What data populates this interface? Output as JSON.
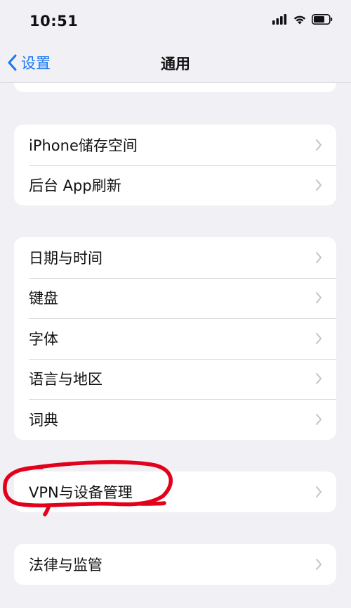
{
  "status_bar": {
    "time": "10:51",
    "icons": [
      "cellular-icon",
      "wifi-icon",
      "battery-icon"
    ]
  },
  "nav": {
    "back_label": "设置",
    "title": "通用",
    "accent_color": "#1877f2"
  },
  "groups": [
    {
      "items": [
        {
          "label": "iPhone储存空间"
        },
        {
          "label": "后台 App刷新"
        }
      ]
    },
    {
      "items": [
        {
          "label": "日期与时间"
        },
        {
          "label": "键盘"
        },
        {
          "label": "字体"
        },
        {
          "label": "语言与地区"
        },
        {
          "label": "词典"
        }
      ]
    },
    {
      "items": [
        {
          "label": "VPN与设备管理"
        }
      ]
    },
    {
      "items": [
        {
          "label": "法律与监管"
        }
      ]
    }
  ],
  "annotation": {
    "color": "#e3001b",
    "target": "VPN与设备管理"
  }
}
